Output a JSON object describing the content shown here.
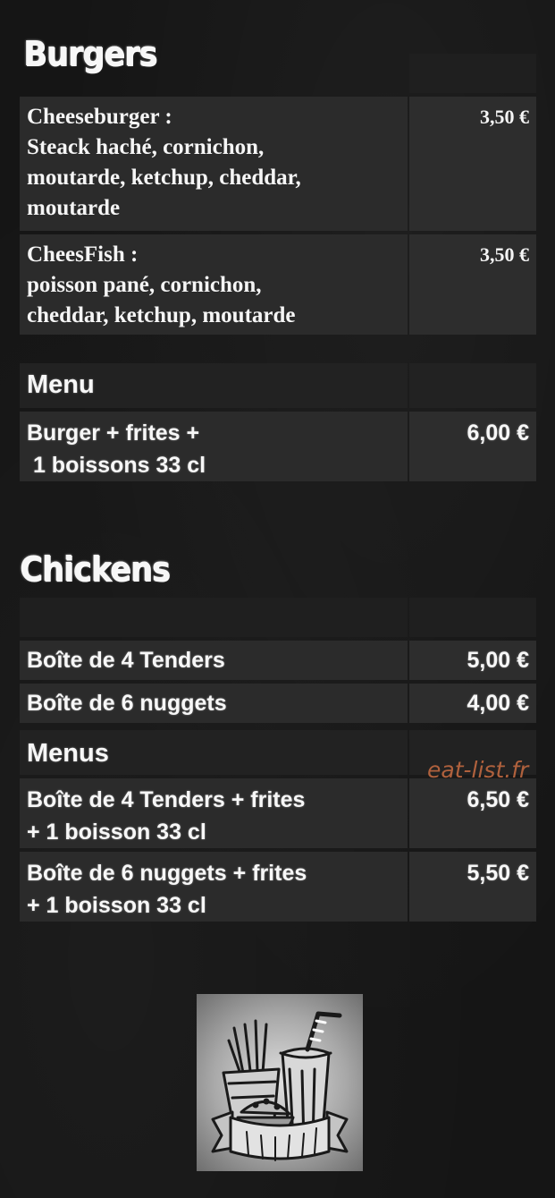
{
  "burgers": {
    "title": "Burgers",
    "items": [
      {
        "name": "Cheeseburger :",
        "desc": "Steack haché, cornichon,\nmoutarde, ketchup, cheddar,\nmoutarde",
        "price": "3,50 €"
      },
      {
        "name": "CheesFish :",
        "desc": "poisson pané, cornichon,\ncheddar, ketchup, moutarde",
        "price": "3,50 €"
      }
    ],
    "menu": {
      "title": "Menu",
      "item": {
        "line1": "Burger + frites +",
        "line2": " 1 boissons 33 cl",
        "price": "6,00 €"
      }
    }
  },
  "chickens": {
    "title": "Chickens",
    "items": [
      {
        "name": "Boîte de 4 Tenders",
        "price": "5,00 €"
      },
      {
        "name": "Boîte de 6 nuggets",
        "price": "4,00 €"
      }
    ],
    "menus": {
      "title": "Menus",
      "items": [
        {
          "line1": "Boîte de 4 Tenders + frites",
          "line2": "+ 1 boisson 33 cl",
          "price": "6,50 €"
        },
        {
          "line1": "Boîte de 6 nuggets + frites",
          "line2": "+ 1 boisson 33 cl",
          "price": "5,50 €"
        }
      ]
    }
  },
  "watermark": "eat-list.fr",
  "logo_icon": "fries-drink-burger-icon"
}
